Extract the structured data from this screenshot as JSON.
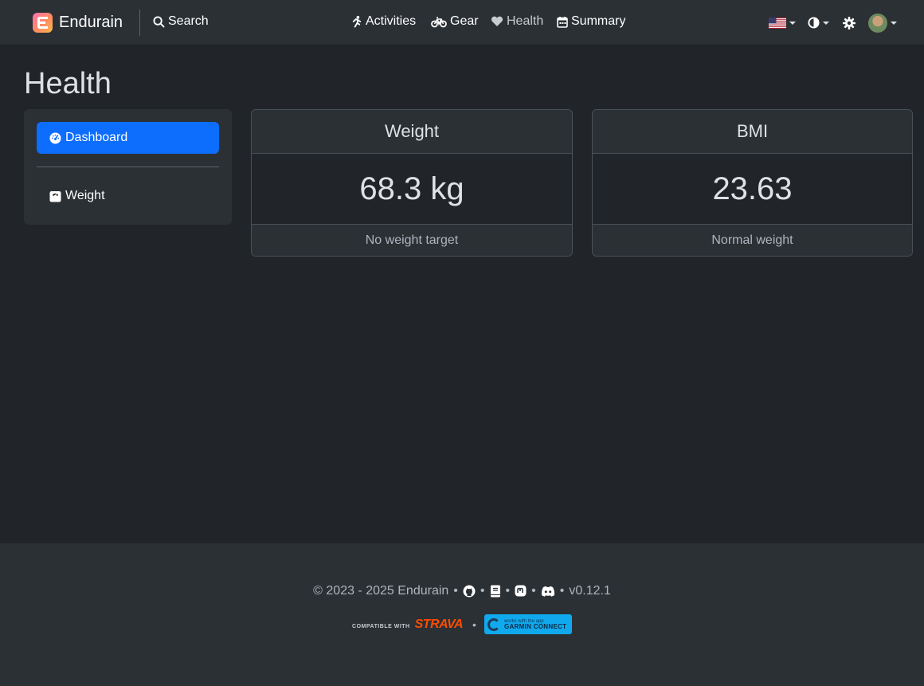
{
  "navbar": {
    "brand": "Endurain",
    "search": "Search",
    "links": [
      "Activities",
      "Gear",
      "Health",
      "Summary"
    ]
  },
  "page": {
    "title": "Health"
  },
  "sidebar": {
    "items": [
      {
        "label": "Dashboard",
        "icon": "gauge-icon",
        "active": true
      },
      {
        "label": "Weight",
        "icon": "weight-scale-icon",
        "active": false
      }
    ]
  },
  "cards": [
    {
      "title": "Weight",
      "value": "68.3 kg",
      "footer": "No weight target"
    },
    {
      "title": "BMI",
      "value": "23.63",
      "footer": "Normal weight"
    }
  ],
  "footer": {
    "copyright": "© 2023 - 2025 Endurain",
    "version": "v0.12.1",
    "strava_small": "COMPATIBLE WITH",
    "strava_big": "STRAVA",
    "garmin_small": "works with the app",
    "garmin_big": "GARMIN CONNECT"
  },
  "colors": {
    "accent": "#0d6efd",
    "background": "#212529",
    "surface": "#2b3035"
  }
}
